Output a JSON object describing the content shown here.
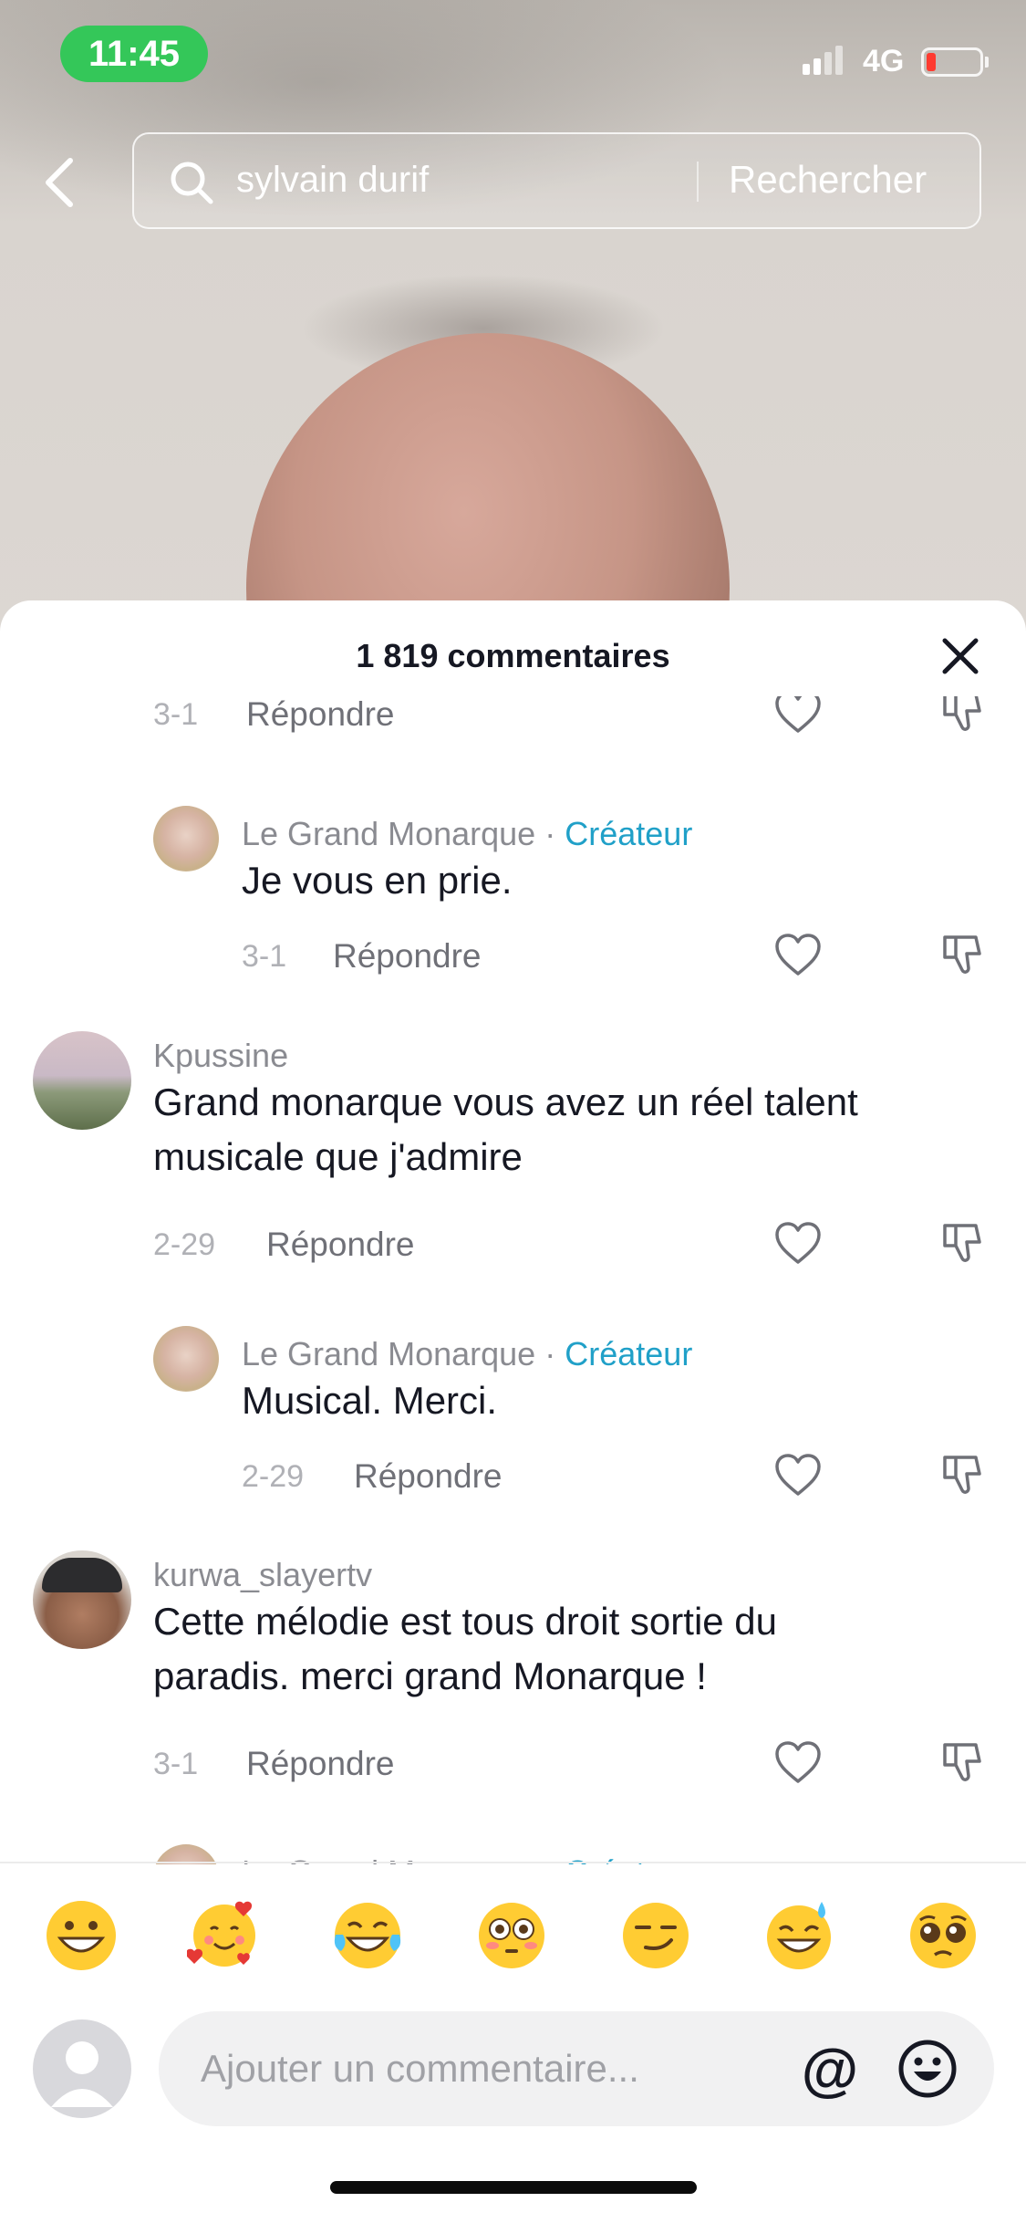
{
  "status_bar": {
    "time": "11:45",
    "network": "4G",
    "time_pill_color": "#34c759",
    "battery_level_color": "#ff3b30"
  },
  "search": {
    "query": "sylvain durif",
    "submit_label": "Rechercher"
  },
  "comments_sheet": {
    "title": "1 819 commentaires",
    "creator_color": "#20a0c8",
    "comments": [
      {
        "date": "3-1",
        "reply_label": "Répondre"
      },
      {
        "author": "Le Grand Monarque",
        "separator": "·",
        "badge": "Créateur",
        "text": "Je vous en prie.",
        "date": "3-1",
        "reply_label": "Répondre"
      },
      {
        "author": "Kpussine",
        "text_line1": "Grand monarque vous avez un réel talent",
        "text_line2": "musicale que j'admire",
        "date": "2-29",
        "reply_label": "Répondre"
      },
      {
        "author": "Le Grand Monarque",
        "separator": "·",
        "badge": "Créateur",
        "text": "Musical. Merci.",
        "date": "2-29",
        "reply_label": "Répondre"
      },
      {
        "author": "kurwa_slayertv",
        "text_line1": "Cette mélodie est tous droit sortie du",
        "text_line2": "paradis. merci grand Monarque !",
        "date": "3-1",
        "reply_label": "Répondre"
      },
      {
        "author": "Le Grand Monarque",
        "separator": "·",
        "badge": "Créateur"
      }
    ]
  },
  "emoji_bar": [
    "grinning-face",
    "smiling-face-with-hearts",
    "face-with-tears-of-joy",
    "flushed-face",
    "smirking-face",
    "grinning-face-with-sweat",
    "pleading-face"
  ],
  "composer": {
    "placeholder": "Ajouter un commentaire...",
    "mention_label": "@"
  }
}
